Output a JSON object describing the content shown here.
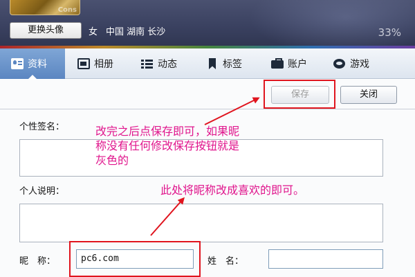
{
  "header": {
    "avatar_watermark": "Cons",
    "change_avatar_label": "更换头像",
    "gender": "女",
    "location": "中国 湖南 长沙",
    "completion": "33%"
  },
  "tabs": [
    {
      "label": "资料",
      "icon": "profile-icon",
      "active": true
    },
    {
      "label": "相册",
      "icon": "album-icon",
      "active": false
    },
    {
      "label": "动态",
      "icon": "list-icon",
      "active": false
    },
    {
      "label": "标签",
      "icon": "bookmark-icon",
      "active": false
    },
    {
      "label": "账户",
      "icon": "wallet-icon",
      "active": false
    },
    {
      "label": "游戏",
      "icon": "game-icon",
      "active": false
    }
  ],
  "toolbar": {
    "save_label": "保存",
    "close_label": "关闭"
  },
  "form": {
    "signature_label": "个性签名：",
    "signature_value": "",
    "description_label": "个人说明：",
    "description_value": "",
    "nickname_label": "昵　称：",
    "nickname_value": "pc6.com",
    "name_label": "姓　名：",
    "name_value": ""
  },
  "annotations": {
    "save_note_line1": "改完之后点保存即可，如果昵",
    "save_note_line2": "称没有任何修改保存按钮就是",
    "save_note_line3": "灰色的",
    "nickname_note": "此处将昵称改成喜欢的即可。"
  },
  "colors": {
    "annotation": "#e0148c",
    "highlight_box": "#e0141e",
    "active_tab": "#5b86c1"
  }
}
